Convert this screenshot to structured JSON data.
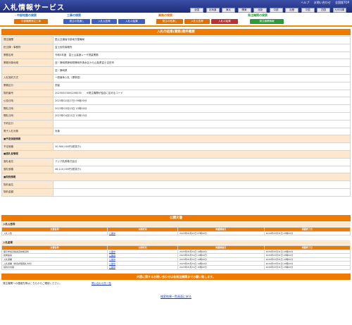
{
  "app": {
    "title": "入札情報サービス"
  },
  "header_links": [
    "ヘルプ",
    "お問い合わせ",
    "全国版TOP"
  ],
  "regions": [
    "全国",
    "北海道",
    "東北",
    "関東",
    "北陸",
    "中部",
    "近畿",
    "中国",
    "四国",
    "九州沖縄"
  ],
  "categories": [
    {
      "label": "・中部地整の検索",
      "color": "#2a6fd0"
    },
    {
      "label": "工事の検索",
      "color": "#2a6fd0"
    },
    {
      "label": "業務の検索",
      "color": "#e07000"
    },
    {
      "label": "発注機関の検索",
      "color": "#2a9a3a"
    }
  ],
  "tabs": [
    {
      "label": "中部機関発注工事",
      "color": "#e07000"
    },
    {
      "label": "発注の見通し",
      "color": "#3b5fc4"
    },
    {
      "label": "入札公告等",
      "color": "#3b5fc4"
    },
    {
      "label": "入札の結果",
      "color": "#3b5fc4"
    },
    {
      "label": "発注の見通し",
      "color": "#e07000"
    },
    {
      "label": "入札公告等",
      "color": "#e07000"
    },
    {
      "label": "入札の結果",
      "color": "#c03030"
    },
    {
      "label": "発注機関情報",
      "color": "#2a9a3a"
    }
  ],
  "detail": {
    "heading": "入札の結果(業務)案件概要",
    "rows": [
      {
        "k": "発注機関",
        "v": "国土交通省中部地方整備局"
      },
      {
        "k": "担当課・事務所",
        "v": "富士砂防事務所"
      },
      {
        "k": "業務名称",
        "v": "令和5年度　富士山高速レーザ測量業務"
      },
      {
        "k": "業務対象地域",
        "v": "自）静岡県静岡県静岡市清水区から山梨県富士吉田市"
      },
      {
        "k": "",
        "v": "至）静岡県"
      },
      {
        "k": "入札契約方式",
        "v": "一般競争入札（標準型）"
      },
      {
        "k": "業務区分",
        "v": "測量"
      },
      {
        "k": "契約番号",
        "v": "20230543000206030　　※発注機関が独自に定めるコード"
      },
      {
        "k": "公告日時",
        "v": "2023年02月27日 09時00分"
      },
      {
        "k": "開札日時",
        "v": "2023年03月13日 10時00分"
      },
      {
        "k": "開札日時",
        "v": "2023年04月21日 10時15分"
      },
      {
        "k": "予約区分",
        "v": ""
      },
      {
        "k": "電子入札対象",
        "v": "対象"
      }
    ],
    "group1": "■予定価格情報",
    "rows_price": [
      {
        "k": "予定価格",
        "v": "30,900,000円(税抜き)"
      }
    ],
    "group2": "■落札者情報",
    "rows_winner": [
      {
        "k": "落札者名",
        "v": "アジア航測株式会社"
      },
      {
        "k": "落札価格",
        "v": "46,110,000円(税抜き)"
      }
    ],
    "group3": "■契約情報",
    "rows_contract": [
      {
        "k": "契約者名",
        "v": ""
      },
      {
        "k": "契約金額",
        "v": ""
      }
    ]
  },
  "public_docs": {
    "heading": "公開文書",
    "notice": {
      "title": "入札公告等",
      "cols": [
        "文書名称",
        "公開状況",
        "掲載開始日",
        "掲載終了日"
      ],
      "rows": [
        [
          "入札公告",
          "公開中",
          "2023年02月27日 07時00分",
          "2024年03月31日 23時00分"
        ]
      ]
    },
    "results": {
      "title": "入札結果",
      "cols": [
        "文書名称",
        "公開状況",
        "掲載開始日",
        "掲載終了日"
      ],
      "rows": [
        [
          "開示参加資格審査技術資料",
          "公開中",
          "2023年05月31日 14時00分",
          "2025年03月31日 23時00分"
        ],
        [
          "技術提案",
          "公開中",
          "2023年05月31日 14時00分",
          "2025年03月31日 23時00分"
        ],
        [
          "入札調書",
          "公開中",
          "2023年05月31日 14時00分",
          "2025年03月31日 23時00分"
        ],
        [
          "入札調書（総合評価落札方式）",
          "公開中",
          "2023年05月31日 14時00分",
          "2025年03月31日 23時00分"
        ],
        [
          "契約の内容",
          "公開中",
          "2023年05月31日 15時00分",
          "2025年03月31日 23時00分"
        ]
      ]
    }
  },
  "footer": {
    "bar": "内容に関するお問い合わせは各発注機関までお願い致します。",
    "note": "発注機関への連絡先等はこちらからご確認ください。",
    "link1": "問い合わせ先一覧",
    "back": "検索結果一覧画面に戻る"
  }
}
